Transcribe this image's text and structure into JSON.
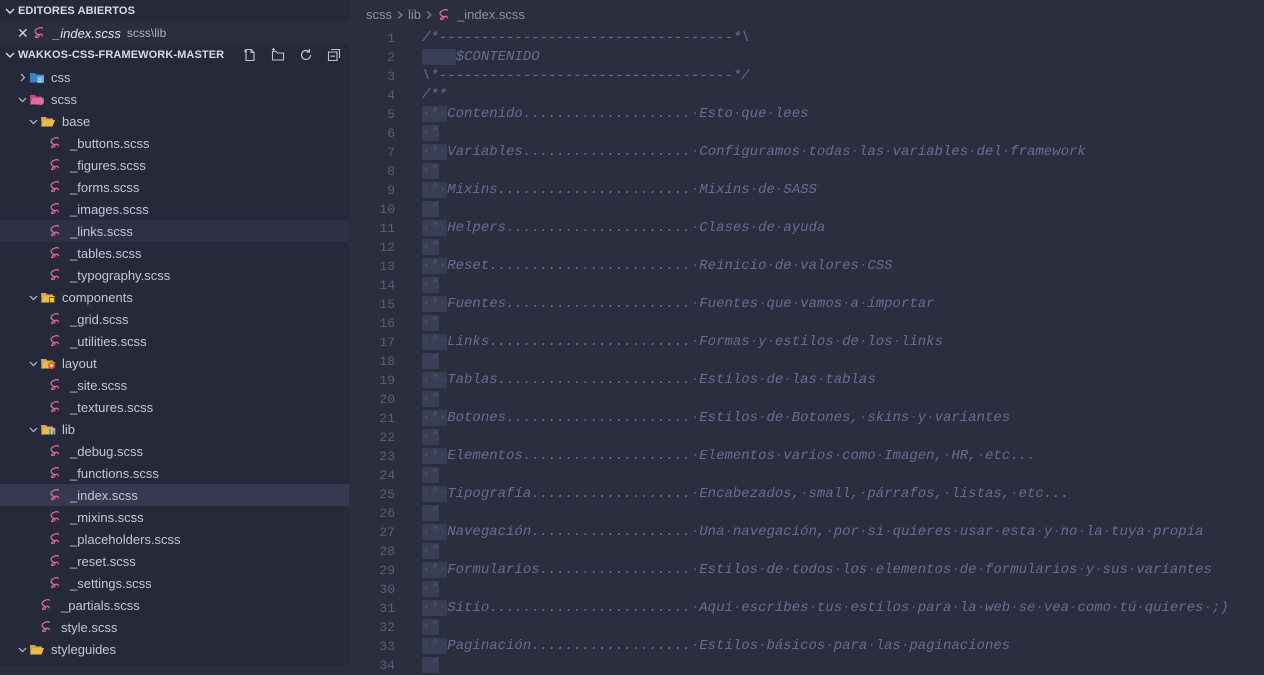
{
  "sidebar": {
    "open_editors": {
      "title": "EDITORES ABIERTOS",
      "items": [
        {
          "name": "_index.scss",
          "path": "scss\\lib"
        }
      ]
    },
    "project": {
      "title": "WAKKOS-CSS-FRAMEWORK-MASTER",
      "actions": [
        "new-file-icon",
        "new-folder-icon",
        "refresh-icon",
        "collapse-all-icon"
      ]
    },
    "tree": [
      {
        "label": "css",
        "depth": 0,
        "kind": "folder",
        "open": false,
        "icon": "css-folder-icon"
      },
      {
        "label": "scss",
        "depth": 0,
        "kind": "folder",
        "open": true,
        "icon": "sass-folder-icon"
      },
      {
        "label": "base",
        "depth": 1,
        "kind": "folder",
        "open": true,
        "icon": "base-folder-icon"
      },
      {
        "label": "_buttons.scss",
        "depth": 2,
        "kind": "file"
      },
      {
        "label": "_figures.scss",
        "depth": 2,
        "kind": "file"
      },
      {
        "label": "_forms.scss",
        "depth": 2,
        "kind": "file"
      },
      {
        "label": "_images.scss",
        "depth": 2,
        "kind": "file"
      },
      {
        "label": "_links.scss",
        "depth": 2,
        "kind": "file",
        "state": "hover"
      },
      {
        "label": "_tables.scss",
        "depth": 2,
        "kind": "file"
      },
      {
        "label": "_typography.scss",
        "depth": 2,
        "kind": "file"
      },
      {
        "label": "components",
        "depth": 1,
        "kind": "folder",
        "open": true,
        "icon": "components-folder-icon"
      },
      {
        "label": "_grid.scss",
        "depth": 2,
        "kind": "file"
      },
      {
        "label": "_utilities.scss",
        "depth": 2,
        "kind": "file"
      },
      {
        "label": "layout",
        "depth": 1,
        "kind": "folder",
        "open": true,
        "icon": "layout-folder-icon"
      },
      {
        "label": "_site.scss",
        "depth": 2,
        "kind": "file"
      },
      {
        "label": "_textures.scss",
        "depth": 2,
        "kind": "file"
      },
      {
        "label": "lib",
        "depth": 1,
        "kind": "folder",
        "open": true,
        "icon": "lib-folder-icon"
      },
      {
        "label": "_debug.scss",
        "depth": 2,
        "kind": "file"
      },
      {
        "label": "_functions.scss",
        "depth": 2,
        "kind": "file"
      },
      {
        "label": "_index.scss",
        "depth": 2,
        "kind": "file",
        "state": "selected"
      },
      {
        "label": "_mixins.scss",
        "depth": 2,
        "kind": "file"
      },
      {
        "label": "_placeholders.scss",
        "depth": 2,
        "kind": "file"
      },
      {
        "label": "_reset.scss",
        "depth": 2,
        "kind": "file"
      },
      {
        "label": "_settings.scss",
        "depth": 2,
        "kind": "file"
      },
      {
        "label": "_partials.scss",
        "depth": 1,
        "kind": "file"
      },
      {
        "label": "style.scss",
        "depth": 1,
        "kind": "file"
      },
      {
        "label": "styleguides",
        "depth": 0,
        "kind": "folder",
        "open": true,
        "icon": "folder-icon"
      }
    ]
  },
  "editor": {
    "breadcrumb": [
      "scss",
      "lib",
      "_index.scss"
    ],
    "lines": [
      {
        "n": "1",
        "ind": "",
        "text": "/*-----------------------------------*\\"
      },
      {
        "n": "2",
        "ind": "····",
        "text": "$CONTENIDO"
      },
      {
        "n": "3",
        "ind": "",
        "text": "\\*-----------------------------------*/"
      },
      {
        "n": "4",
        "ind": "",
        "text": "/**"
      },
      {
        "n": "5",
        "ind": "·*·",
        "text": "Contenido....................·Esto·que·lees"
      },
      {
        "n": "6",
        "ind": "·*",
        "text": ""
      },
      {
        "n": "7",
        "ind": "·*·",
        "text": "Variables....................·Configuramos·todas·las·variables·del·framework"
      },
      {
        "n": "8",
        "ind": "·*",
        "text": ""
      },
      {
        "n": "9",
        "ind": "·*·",
        "text": "Mixins.......................·Mixins·de·SASS"
      },
      {
        "n": "10",
        "ind": "·*",
        "text": ""
      },
      {
        "n": "11",
        "ind": "·*·",
        "text": "Helpers......................·Clases·de·ayuda"
      },
      {
        "n": "12",
        "ind": "·*",
        "text": ""
      },
      {
        "n": "13",
        "ind": "·*·",
        "text": "Reset........................·Reinicio·de·valores·CSS"
      },
      {
        "n": "14",
        "ind": "·*",
        "text": ""
      },
      {
        "n": "15",
        "ind": "·*·",
        "text": "Fuentes......................·Fuentes·que·vamos·a·importar"
      },
      {
        "n": "16",
        "ind": "·*",
        "text": ""
      },
      {
        "n": "17",
        "ind": "·*·",
        "text": "Links........................·Formas·y·estilos·de·los·links"
      },
      {
        "n": "18",
        "ind": "·*",
        "text": ""
      },
      {
        "n": "19",
        "ind": "·*·",
        "text": "Tablas.......................·Estilos·de·las·tablas"
      },
      {
        "n": "20",
        "ind": "·*",
        "text": ""
      },
      {
        "n": "21",
        "ind": "·*·",
        "text": "Botones......................·Estilos·de·Botones,·skins·y·variantes"
      },
      {
        "n": "22",
        "ind": "·*",
        "text": ""
      },
      {
        "n": "23",
        "ind": "·*·",
        "text": "Elementos....................·Elementos·varios·como·Imagen,·HR,·etc..."
      },
      {
        "n": "24",
        "ind": "·*",
        "text": ""
      },
      {
        "n": "25",
        "ind": "·*·",
        "text": "Tipografía...................·Encabezados,·small,·párrafos,·listas,·etc..."
      },
      {
        "n": "26",
        "ind": "·*",
        "text": ""
      },
      {
        "n": "27",
        "ind": "·*·",
        "text": "Navegación...................·Una·navegación,·por·si·quieres·usar·esta·y·no·la·tuya·propia"
      },
      {
        "n": "28",
        "ind": "·*",
        "text": ""
      },
      {
        "n": "29",
        "ind": "·*·",
        "text": "Formularios..................·Estilos·de·todos·los·elementos·de·formularios·y·sus·variantes"
      },
      {
        "n": "30",
        "ind": "·*",
        "text": ""
      },
      {
        "n": "31",
        "ind": "·*·",
        "text": "Sitio........................·Aquí·escribes·tus·estilos·para·la·web·se·vea·como·tú·quieres·;)"
      },
      {
        "n": "32",
        "ind": "·*",
        "text": ""
      },
      {
        "n": "33",
        "ind": "·*·",
        "text": "Paginación...................·Estilos·básicos·para·las·paginaciones"
      },
      {
        "n": "34",
        "ind": "·*",
        "text": ""
      }
    ]
  },
  "colors": {
    "sidebar_bg": "#262939",
    "editor_bg": "#2b2e3f",
    "comment": "#686c92",
    "sass_pink": "#e06c9f",
    "selected_row": "#353952"
  }
}
